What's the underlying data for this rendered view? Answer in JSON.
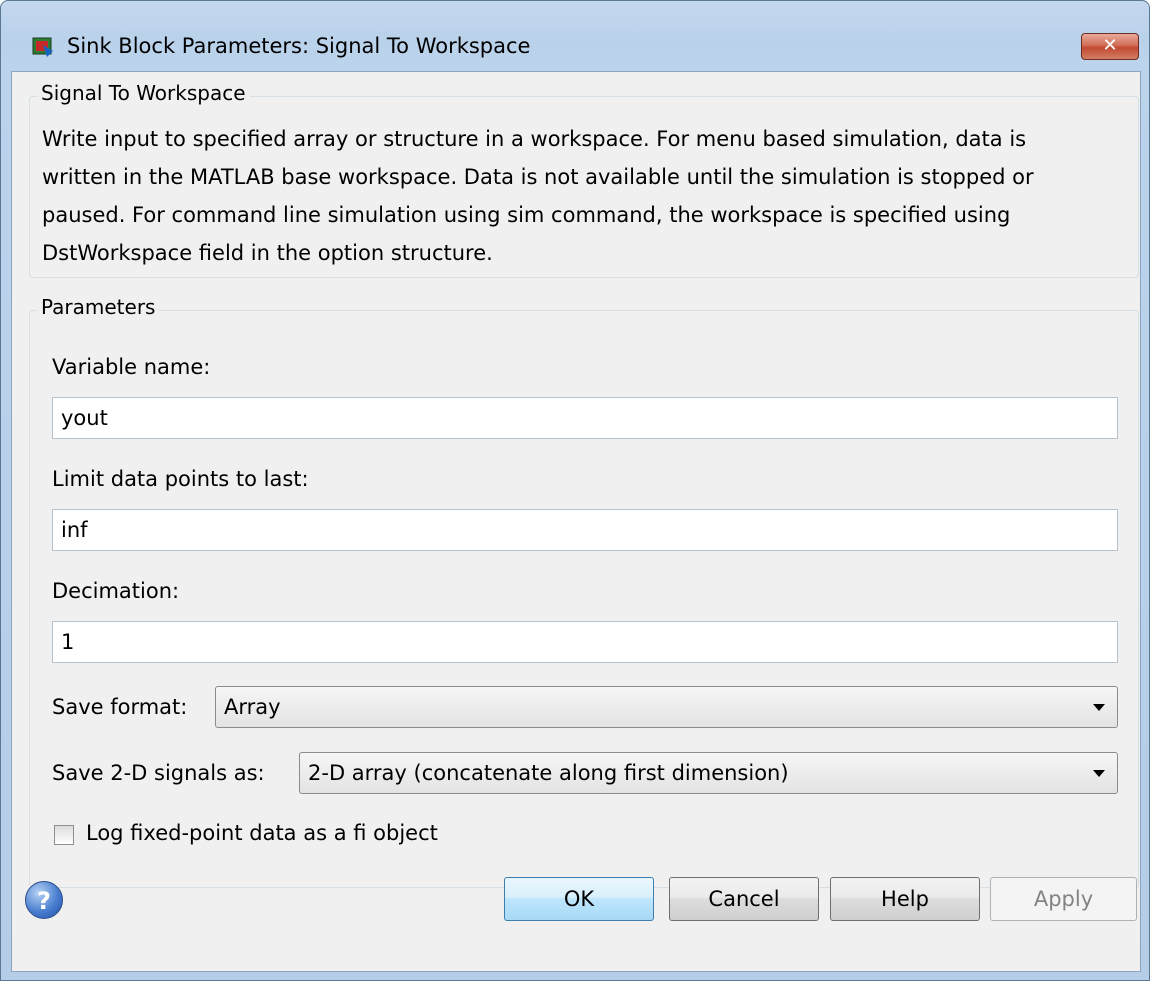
{
  "window": {
    "title": "Sink Block Parameters: Signal To Workspace",
    "close_label": "✕"
  },
  "description_group": {
    "legend": "Signal To Workspace",
    "lines": [
      "Write input to specified array or structure in a workspace. For menu based simulation, data is",
      "written in the MATLAB base workspace. Data is not available until the simulation is stopped or",
      "paused. For command line simulation using sim command, the workspace is specified using",
      "DstWorkspace field in the option structure."
    ]
  },
  "parameters": {
    "legend": "Parameters",
    "variable_name_label": "Variable name:",
    "variable_name_value": "yout",
    "limit_label": "Limit data points to last:",
    "limit_value": "inf",
    "decimation_label": "Decimation:",
    "decimation_value": "1",
    "save_format_label": "Save format:",
    "save_format_value": "Array",
    "save_2d_label": "Save 2-D signals as:",
    "save_2d_value": "2-D array (concatenate along first dimension)",
    "log_fixed_point_label": "Log fixed-point data as a fi object",
    "log_fixed_point_checked": false
  },
  "buttons": {
    "ok": "OK",
    "cancel": "Cancel",
    "help": "Help",
    "apply": "Apply",
    "help_icon": "?"
  },
  "icons": {
    "app": "simulink-block-icon",
    "close": "close-icon",
    "help": "help-question-icon",
    "dropdown": "chevron-down-icon"
  }
}
